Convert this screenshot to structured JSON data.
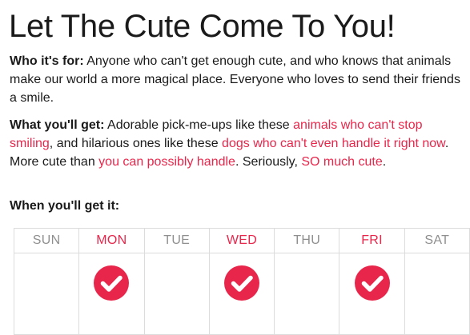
{
  "title": "Let The Cute Come To You!",
  "who": {
    "label": "Who it's for:",
    "text": " Anyone who can't get enough cute, and who knows that animals make our world a more magical place. Everyone who loves to send their friends a smile."
  },
  "what": {
    "label": "What you'll get:",
    "text1": " Adorable pick-me-ups like these ",
    "link1": "animals who can't stop smiling",
    "text2": ", and hilarious ones like these ",
    "link2": "dogs who can't even handle it right now",
    "text3": ". More cute than ",
    "link3": "you can possibly handle",
    "text4": ". Seriously, ",
    "link4": "SO much cute",
    "text5": "."
  },
  "when": {
    "label": "When you'll get it:"
  },
  "calendar": {
    "days": [
      {
        "label": "SUN",
        "checked": false
      },
      {
        "label": "MON",
        "checked": true
      },
      {
        "label": "TUE",
        "checked": false
      },
      {
        "label": "WED",
        "checked": true
      },
      {
        "label": "THU",
        "checked": false
      },
      {
        "label": "FRI",
        "checked": true
      },
      {
        "label": "SAT",
        "checked": false
      }
    ]
  },
  "colors": {
    "accent": "#e8264b",
    "muted": "#8f8f8f",
    "text": "#1a1a1a"
  },
  "icons": {
    "check": "checkmark-circle-icon"
  }
}
